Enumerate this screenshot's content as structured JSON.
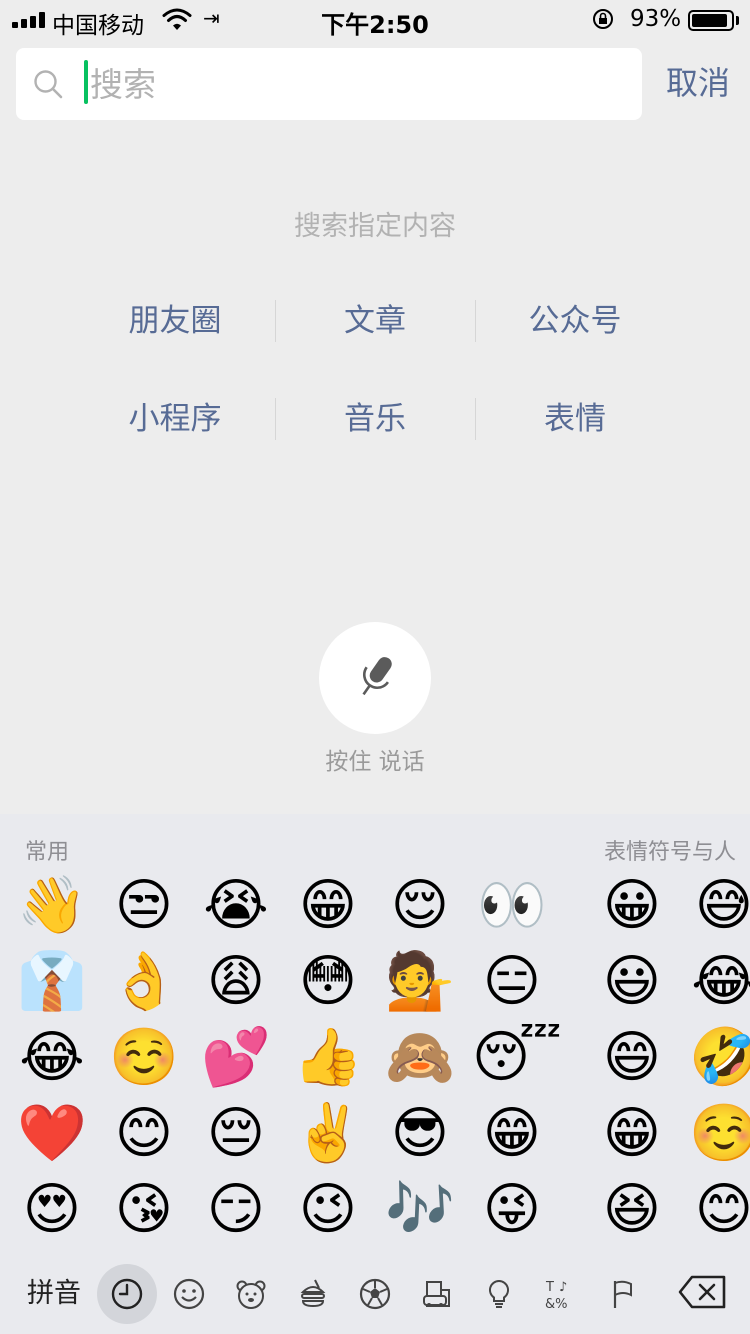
{
  "status_bar": {
    "carrier": "中国移动",
    "time": "下午2:50",
    "battery_percent": "93%",
    "battery_level": 0.93
  },
  "search": {
    "placeholder": "搜索",
    "value": "",
    "cancel_label": "取消"
  },
  "scope": {
    "title": "搜索指定内容",
    "rows": [
      [
        "朋友圈",
        "文章",
        "公众号"
      ],
      [
        "小程序",
        "音乐",
        "表情"
      ]
    ]
  },
  "voice": {
    "label": "按住 说话"
  },
  "keyboard": {
    "section_frequent": "常用",
    "section_people": "表情符号与人",
    "frequent_emoji": [
      [
        "👋",
        "😒",
        "😭",
        "😁",
        "😌",
        "👀"
      ],
      [
        "👔",
        "👌",
        "😩",
        "😳",
        "💁",
        "😑"
      ],
      [
        "😂",
        "☺️",
        "💕",
        "👍",
        "🙈",
        "😴"
      ],
      [
        "❤️",
        "😊",
        "😔",
        "✌️",
        "😎",
        "😁"
      ],
      [
        "😍",
        "😘",
        "😏",
        "😉",
        "🎶",
        "😜"
      ]
    ],
    "people_emoji": [
      [
        "😀",
        "😅"
      ],
      [
        "😃",
        "😂"
      ],
      [
        "😄",
        "🤣"
      ],
      [
        "😁",
        "☺️"
      ],
      [
        "😆",
        "😊"
      ]
    ],
    "toolbar": {
      "pinyin_label": "拼音",
      "categories": [
        "clock-icon",
        "smiley-icon",
        "bear-icon",
        "food-icon",
        "ball-icon",
        "building-icon",
        "bulb-icon",
        "symbols-icon",
        "flag-icon"
      ],
      "active_category": "clock-icon"
    }
  }
}
